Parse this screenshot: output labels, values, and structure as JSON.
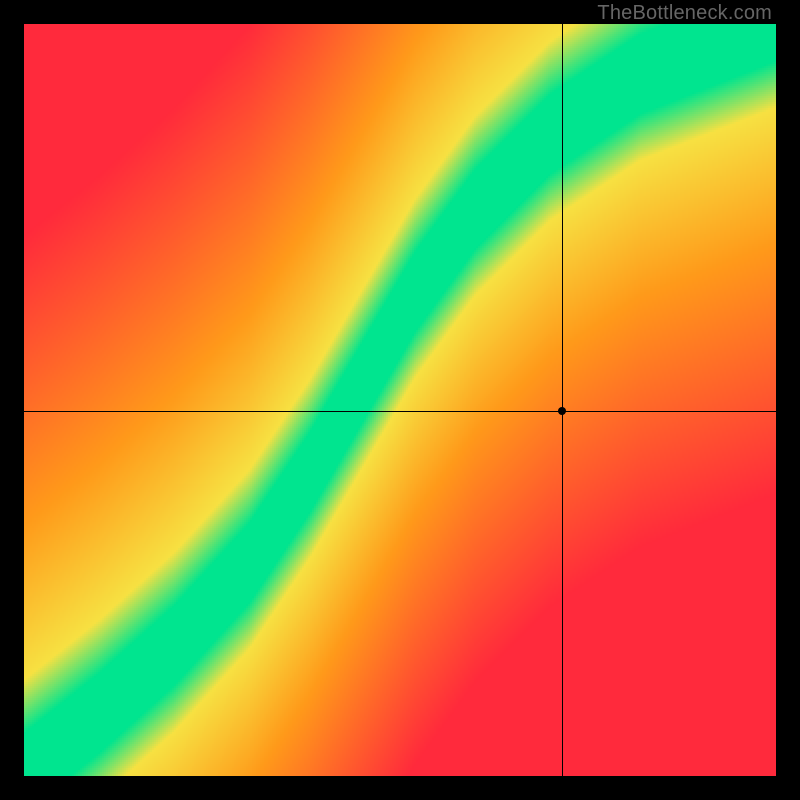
{
  "watermark_text": "TheBottleneck.com",
  "chart_data": {
    "type": "heatmap",
    "title": "",
    "xlabel": "",
    "ylabel": "",
    "xlim": [
      0,
      1
    ],
    "ylim": [
      0,
      1
    ],
    "crosshair": {
      "x": 0.715,
      "y": 0.485
    },
    "optimal_curve": {
      "description": "green diagonal band indicating balanced pairing",
      "points_xy": [
        [
          0.0,
          0.0
        ],
        [
          0.1,
          0.08
        ],
        [
          0.2,
          0.17
        ],
        [
          0.3,
          0.28
        ],
        [
          0.38,
          0.4
        ],
        [
          0.45,
          0.52
        ],
        [
          0.52,
          0.64
        ],
        [
          0.6,
          0.75
        ],
        [
          0.7,
          0.85
        ],
        [
          0.82,
          0.93
        ],
        [
          1.0,
          1.0
        ]
      ],
      "band_halfwidth_vertical": 0.045
    },
    "color_scale": {
      "optimal": "#00e58f",
      "near": "#f7e142",
      "mid": "#ff9a1a",
      "far": "#ff2a3c"
    },
    "crosshair_zone": "near-to-mid (yellow-orange), point is to the right of optimal band"
  }
}
